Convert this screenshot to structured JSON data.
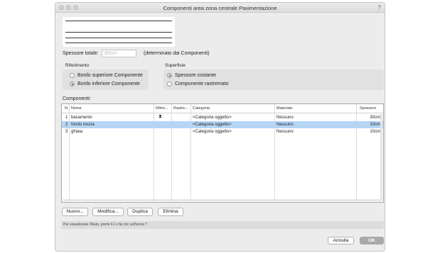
{
  "window": {
    "title": "Componenti area zona centrale Pavimentazione"
  },
  "spessore": {
    "label": "Spessore totale:",
    "value": "80cm",
    "note": "(determinato dai Componenti)"
  },
  "riferimento": {
    "label": "Riferimento",
    "options": [
      "Bordo superiore Componente",
      "Bordo inferiore Componente"
    ],
    "selected": "Bordo inferiore Componente"
  },
  "superficie": {
    "label": "Superficie",
    "options": [
      "Spessore costante",
      "Componente rastremato"
    ],
    "selected": "Spessore costante"
  },
  "componenti": {
    "label": "Componenti:",
    "columns": [
      "N.",
      "Nome",
      "Riferi...",
      "Rastre...",
      "Categoria",
      "Materiale",
      "Spessore"
    ],
    "rows": [
      {
        "n": "1",
        "nome": "basamento",
        "riferimento": "⧗",
        "rastremato": "",
        "categoria": "<Categoria oggetto>",
        "materiale": "Nessuno",
        "spessore": "30cm",
        "selected": false
      },
      {
        "n": "2",
        "nome": "fondo roccia",
        "riferimento": "",
        "rastremato": "",
        "categoria": "<Categoria oggetto>",
        "materiale": "Nessuno",
        "spessore": "10cm",
        "selected": true
      },
      {
        "n": "3",
        "nome": "ghiaia",
        "riferimento": "",
        "rastremato": "",
        "categoria": "<Categoria oggetto>",
        "materiale": "Nessuno",
        "spessore": "10cm",
        "selected": false
      }
    ]
  },
  "buttons": {
    "nuovo": "Nuovo...",
    "modifica": "Modifica...",
    "duplica": "Duplica",
    "elimina": "Elimina",
    "annulla": "Annulla",
    "ok": "OK"
  },
  "status_text": "Per visualizzare l'Aiuto, premi F1 o fai clic sull'icona ?",
  "icons": {
    "help": "question-mark-icon"
  }
}
